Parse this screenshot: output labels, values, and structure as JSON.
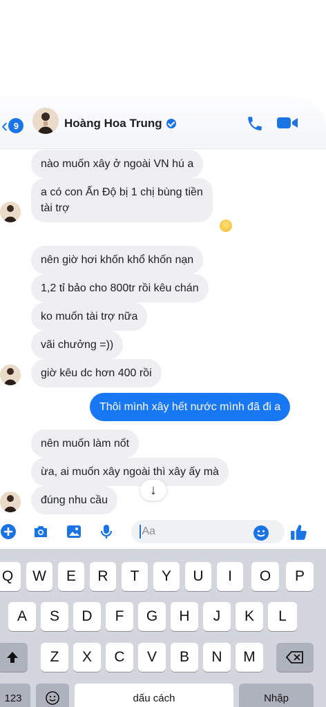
{
  "header": {
    "back_count": "9",
    "contact_name": "Hoàng Hoa Trung"
  },
  "messages": [
    {
      "text": "nào muốn xây ở ngoài VN hú a"
    },
    {
      "text": "a có con Ấn Độ bị 1 chị bùng tiền\ntài trợ"
    },
    {
      "text": "nên giờ hơi khốn khổ khốn nạn"
    },
    {
      "text": "1,2 tỉ bảo cho 800tr rồi kêu chán"
    },
    {
      "text": "ko muốn tài trợ nữa"
    },
    {
      "text": "vãi chưởng =))"
    },
    {
      "text": "giờ kêu dc hơn 400 rồi"
    },
    {
      "text": "Thôi mình xây hết nước mình đã đi a"
    },
    {
      "text": "nên muốn làm nốt"
    },
    {
      "text": "ừa, ai muốn xây ngoài thì xây ấy mà"
    },
    {
      "text": "đúng nhu cầu"
    }
  ],
  "composer": {
    "placeholder": "Aa"
  },
  "keyboard": {
    "row1": [
      "Q",
      "W",
      "E",
      "R",
      "T",
      "Y",
      "U",
      "I",
      "O",
      "P"
    ],
    "row2": [
      "A",
      "S",
      "D",
      "F",
      "G",
      "H",
      "J",
      "K",
      "L"
    ],
    "row3": [
      "Z",
      "X",
      "C",
      "V",
      "B",
      "N",
      "M"
    ],
    "numbers_key": "123",
    "space_key": "dấu cách",
    "return_key": "Nhập"
  },
  "colors": {
    "accent": "#1877f2",
    "incoming_bubble": "#efeff1",
    "keyboard_bg": "#d3d6dc"
  }
}
